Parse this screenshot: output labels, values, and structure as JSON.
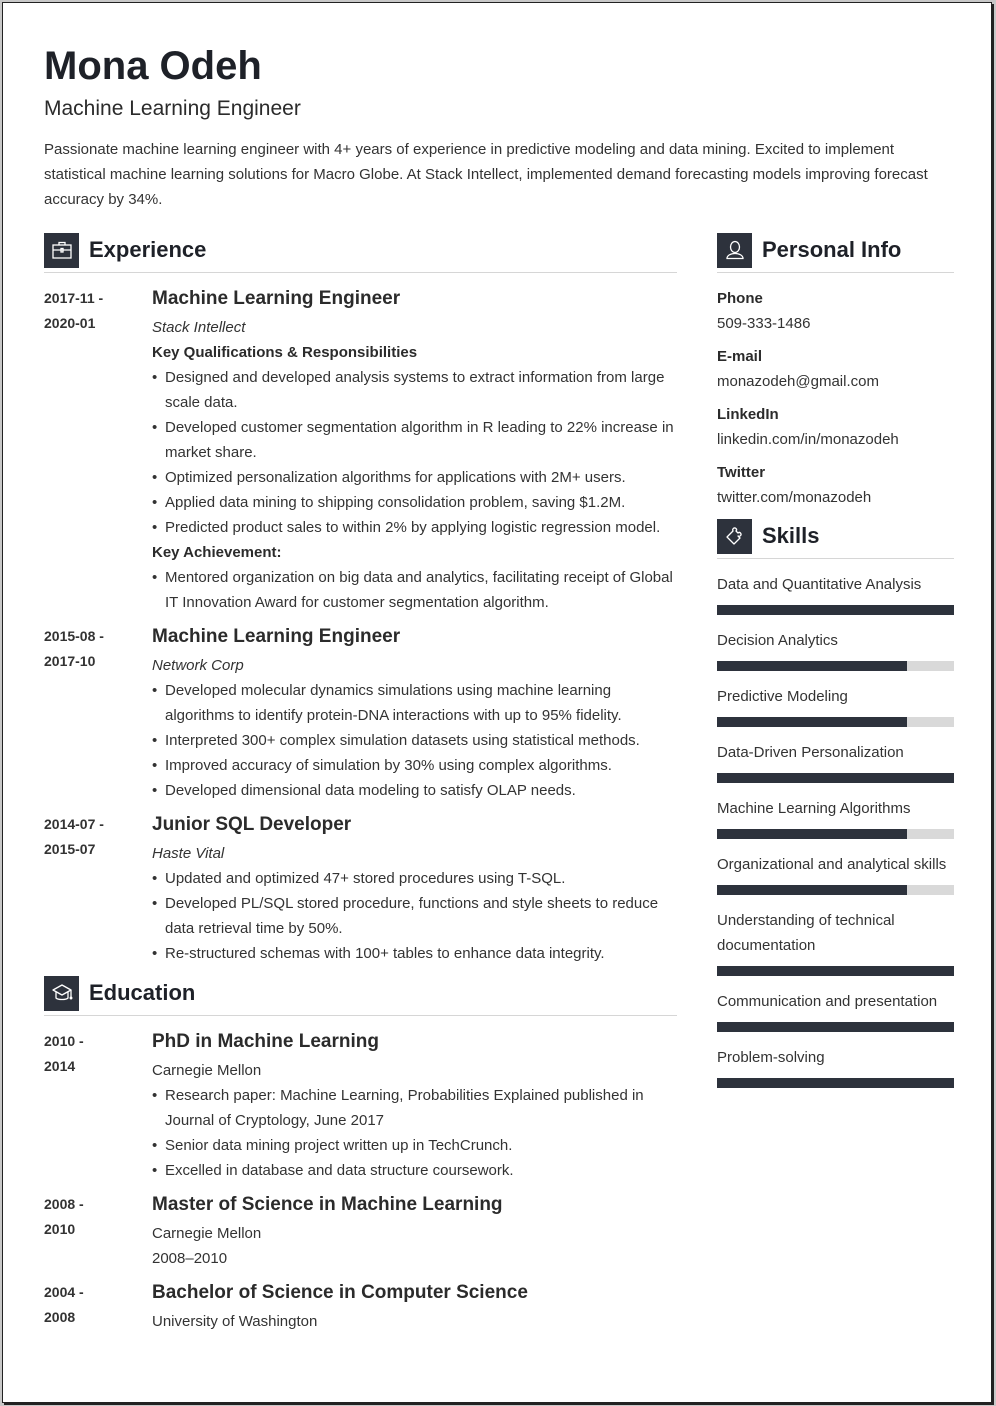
{
  "header": {
    "name": "Mona Odeh",
    "title": "Machine Learning Engineer",
    "summary": "Passionate machine learning engineer with 4+ years of experience in predictive modeling and data mining. Excited to implement statistical machine learning solutions for Macro Globe. At Stack Intellect, implemented demand forecasting models improving forecast accuracy by 34%."
  },
  "colors": {
    "accent": "#2d323c",
    "bar_track": "#d9d9d9",
    "divider": "#d6d6d6"
  },
  "experience": {
    "heading": "Experience",
    "icon": "briefcase-icon",
    "entries": [
      {
        "date_start": "2017-11 -",
        "date_end": "2020-01",
        "title": "Machine Learning Engineer",
        "company": "Stack Intellect",
        "subheading1": "Key Qualifications & Responsibilities",
        "bullets1": [
          "Designed and developed analysis systems to extract information from large scale data.",
          "Developed customer segmentation algorithm in R leading to 22% increase in market share.",
          "Optimized personalization algorithms for applications with 2M+ users.",
          "Applied data mining to shipping consolidation problem, saving $1.2M.",
          "Predicted product sales to within 2% by applying logistic regression model."
        ],
        "subheading2": "Key Achievement:",
        "bullets2": [
          "Mentored organization on big data and analytics, facilitating receipt of Global IT Innovation Award for customer segmentation algorithm."
        ]
      },
      {
        "date_start": "2015-08 -",
        "date_end": "2017-10",
        "title": "Machine Learning Engineer",
        "company": "Network Corp",
        "bullets": [
          "Developed molecular dynamics simulations using machine learning algorithms to identify protein-DNA interactions with up to 95% fidelity.",
          "Interpreted 300+ complex simulation datasets using statistical methods.",
          "Improved accuracy of simulation by 30% using complex algorithms.",
          "Developed dimensional data modeling to satisfy OLAP needs."
        ]
      },
      {
        "date_start": "2014-07 -",
        "date_end": "2015-07",
        "title": "Junior SQL Developer",
        "company": "Haste Vital",
        "bullets": [
          "Updated and optimized 47+ stored procedures using T-SQL.",
          "Developed PL/SQL stored procedure, functions and style sheets to reduce data retrieval time by 50%.",
          "Re-structured schemas with 100+ tables to enhance data integrity."
        ]
      }
    ]
  },
  "education": {
    "heading": "Education",
    "icon": "graduation-cap-icon",
    "entries": [
      {
        "date_start": "2010 -",
        "date_end": "2014",
        "degree": "PhD in Machine Learning",
        "school": "Carnegie Mellon",
        "bullets": [
          "Research paper: Machine Learning, Probabilities Explained published in Journal of Cryptology, June 2017",
          "Senior data mining project written up in TechCrunch.",
          "Excelled in database and data structure coursework."
        ]
      },
      {
        "date_start": "2008 -",
        "date_end": "2010",
        "degree": "Master of Science in Machine Learning",
        "school": "Carnegie Mellon",
        "extra": "2008–2010"
      },
      {
        "date_start": "2004 -",
        "date_end": "2008",
        "degree": "Bachelor of Science in Computer Science",
        "school": "University of Washington"
      }
    ]
  },
  "personal_info": {
    "heading": "Personal Info",
    "icon": "user-icon",
    "items": [
      {
        "label": "Phone",
        "value": "509-333-1486"
      },
      {
        "label": "E-mail",
        "value": "monazodeh@gmail.com"
      },
      {
        "label": "LinkedIn",
        "value": "linkedin.com/in/monazodeh"
      },
      {
        "label": "Twitter",
        "value": "twitter.com/monazodeh"
      }
    ]
  },
  "skills": {
    "heading": "Skills",
    "icon": "puzzle-piece-icon",
    "items": [
      {
        "name": "Data and Quantitative Analysis",
        "level": 1.0
      },
      {
        "name": "Decision Analytics",
        "level": 0.8
      },
      {
        "name": "Predictive Modeling",
        "level": 0.8
      },
      {
        "name": "Data-Driven Personalization",
        "level": 1.0
      },
      {
        "name": "Machine Learning Algorithms",
        "level": 0.8
      },
      {
        "name": "Organizational and analytical skills",
        "level": 0.8
      },
      {
        "name": "Understanding of technical documentation",
        "level": 1.0
      },
      {
        "name": "Communication and presentation",
        "level": 1.0
      },
      {
        "name": "Problem-solving",
        "level": 1.0
      }
    ]
  }
}
